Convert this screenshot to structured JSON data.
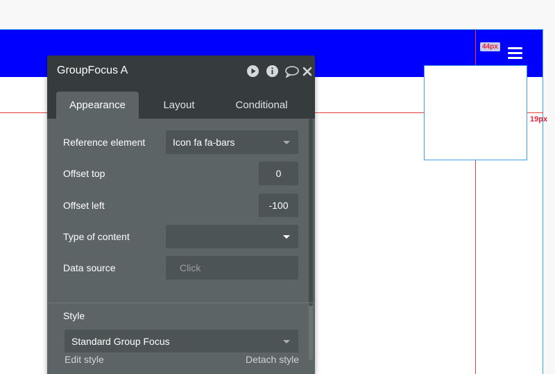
{
  "canvas": {
    "guide_labels": {
      "top_distance": "44px",
      "right_distance": "19px"
    },
    "colors": {
      "header": "#0000ff",
      "guide": "#e8413a",
      "selection": "#3f9fe8"
    }
  },
  "panel": {
    "title": "GroupFocus A",
    "title_icons": [
      "play-icon",
      "info-icon",
      "comment-icon",
      "close-icon"
    ],
    "tabs": [
      {
        "label": "Appearance",
        "active": true
      },
      {
        "label": "Layout",
        "active": false
      },
      {
        "label": "Conditional",
        "active": false
      }
    ],
    "fields": {
      "reference_element": {
        "label": "Reference element",
        "value": "Icon fa fa-bars"
      },
      "offset_top": {
        "label": "Offset top",
        "value": "0"
      },
      "offset_left": {
        "label": "Offset left",
        "value": "-100"
      },
      "type_of_content": {
        "label": "Type of content",
        "value": ""
      },
      "data_source": {
        "label": "Data source",
        "placeholder": "Click"
      }
    },
    "style": {
      "heading": "Style",
      "value": "Standard Group Focus",
      "edit_link": "Edit style",
      "detach_link": "Detach style"
    },
    "colors": {
      "titlebar": "#363c3e",
      "body": "#5d6466",
      "field": "#4d5456"
    }
  }
}
